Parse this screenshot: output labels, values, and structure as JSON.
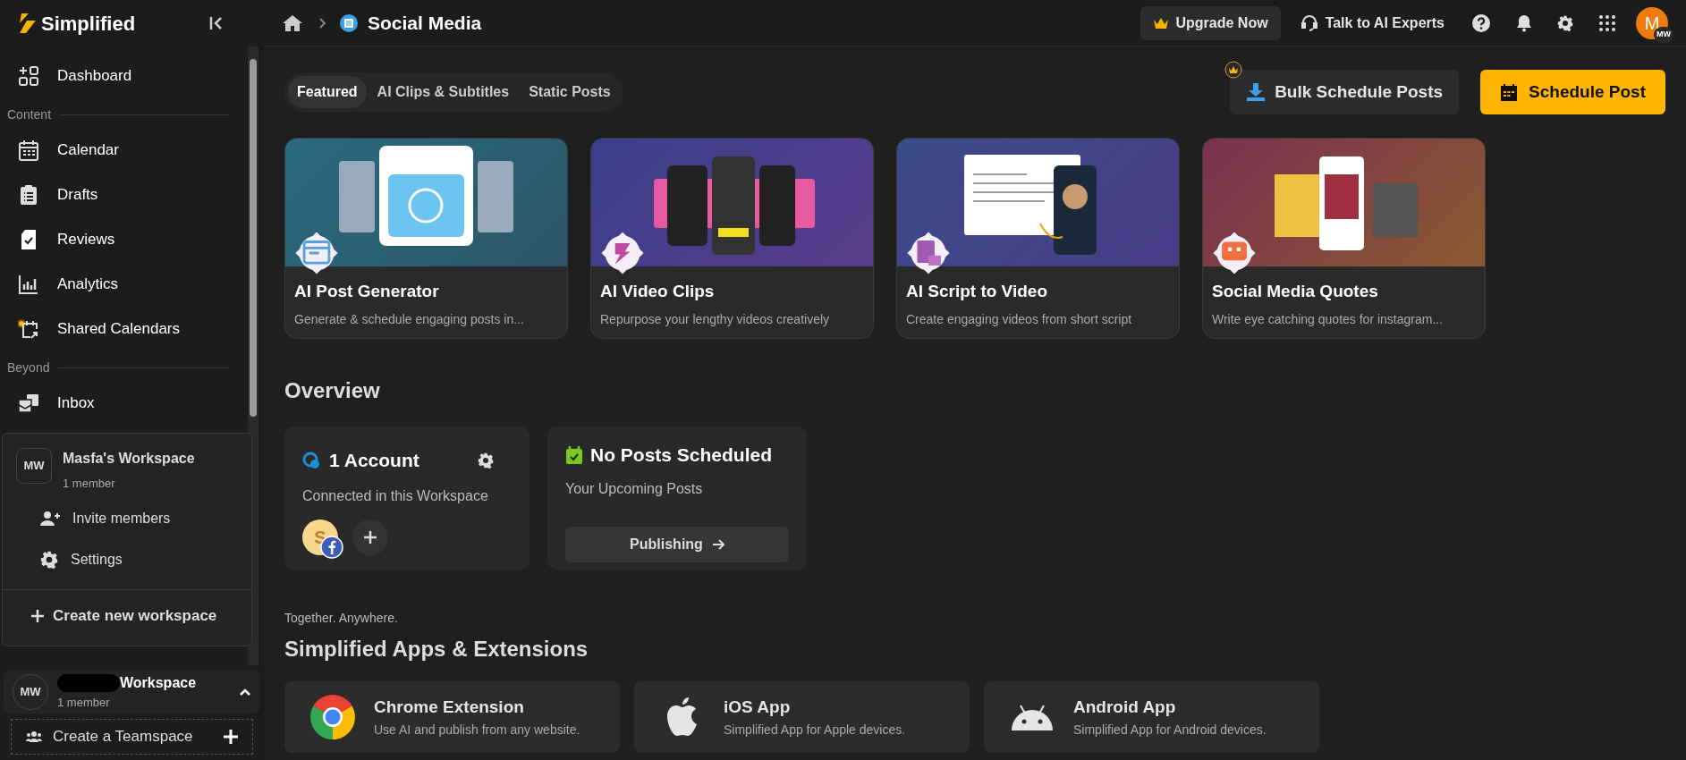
{
  "logo": "Simplified",
  "sidebar": {
    "items": [
      {
        "kind": "link",
        "label": "Dashboard"
      },
      {
        "kind": "section",
        "label": "Content"
      },
      {
        "kind": "link",
        "label": "Calendar"
      },
      {
        "kind": "link",
        "label": "Drafts"
      },
      {
        "kind": "link",
        "label": "Reviews"
      },
      {
        "kind": "link",
        "label": "Analytics"
      },
      {
        "kind": "link",
        "label": "Shared Calendars"
      },
      {
        "kind": "section",
        "label": "Beyond"
      },
      {
        "kind": "link",
        "label": "Inbox"
      }
    ]
  },
  "workspace_menu": {
    "initials": "MW",
    "name": "Masfa's Workspace",
    "members": "1 member",
    "actions": [
      "Invite members",
      "Settings"
    ],
    "create": "Create new workspace"
  },
  "workspace": {
    "initials": "MW",
    "name": "Workspace",
    "members": "1 member",
    "expanded": true,
    "teamspace": "Create a Teamspace"
  },
  "breadcrumb": {
    "title": "Social Media"
  },
  "header": {
    "upgrade": "Upgrade Now",
    "experts": "Talk to AI Experts",
    "avatar": "M",
    "avatar_badge": "MW"
  },
  "tabs": [
    {
      "label": "Featured",
      "selected": true
    },
    {
      "label": "AI Clips & Subtitles",
      "selected": false
    },
    {
      "label": "Static Posts",
      "selected": false
    }
  ],
  "actions": {
    "bulk": "Bulk Schedule Posts",
    "schedule": "Schedule Post"
  },
  "features": [
    {
      "title": "AI Post Generator",
      "description": "Generate & schedule engaging posts in..."
    },
    {
      "title": "AI Video Clips",
      "description": "Repurpose your lengthy videos creatively"
    },
    {
      "title": "AI Script to Video",
      "description": "Create engaging videos from short script"
    },
    {
      "title": "Social Media Quotes",
      "description": "Write eye catching quotes for instagram..."
    }
  ],
  "overview": {
    "title": "Overview",
    "accounts": {
      "title": "1 Account",
      "subtitle": "Connected in this Workspace",
      "avatar": "S"
    },
    "posts": {
      "title": "No Posts Scheduled",
      "subtitle": "Your Upcoming Posts",
      "button": "Publishing"
    }
  },
  "apps": {
    "eyebrow": "Together. Anywhere.",
    "title": "Simplified Apps & Extensions",
    "items": [
      {
        "title": "Chrome Extension",
        "description": "Use AI and publish from any website."
      },
      {
        "title": "iOS App",
        "description": "Simplified App for Apple devices."
      },
      {
        "title": "Android App",
        "description": "Simplified App for Android devices."
      }
    ]
  }
}
